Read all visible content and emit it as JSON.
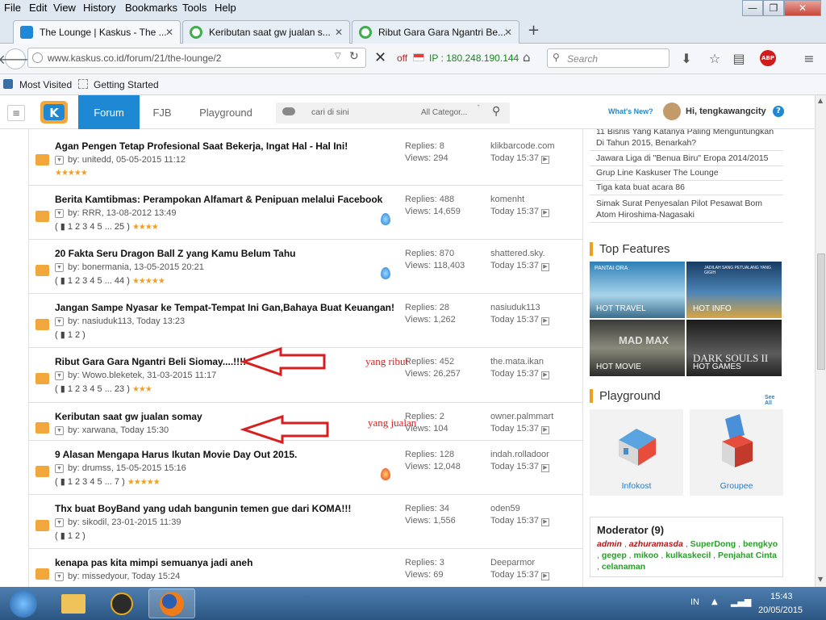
{
  "menu": [
    "File",
    "Edit",
    "View",
    "History",
    "Bookmarks",
    "Tools",
    "Help"
  ],
  "tabs": [
    {
      "title": "The Lounge | Kaskus - The ...",
      "active": true
    },
    {
      "title": "Keributan saat gw jualan s...",
      "active": false
    },
    {
      "title": "Ribut Gara Gara Ngantri Be...",
      "active": false
    }
  ],
  "new_tab": "+",
  "url": "www.kaskus.co.id/forum/21/the-lounge/2",
  "ip_off": "off",
  "ip_text": "IP : 180.248.190.144",
  "search_placeholder": "Search",
  "bookmarks": [
    "Most Visited",
    "Getting Started"
  ],
  "site": {
    "nav": [
      "Forum",
      "FJB",
      "Playground"
    ],
    "search_placeholder": "cari di sini",
    "category": "All Categor...",
    "whats_new": "What's New?",
    "greeting": "Hi, tengkawangcity",
    "help": "?"
  },
  "threads": [
    {
      "title": "Agan Pengen Tetap Profesional Saat Bekerja, Ingat Hal - Hal Ini!",
      "by": "by:",
      "author": "unitedd, 05-05-2015 11:12",
      "pages": "",
      "stars": "★★★★★",
      "replies": "Replies: 8",
      "views": "Views: 294",
      "last_user": "klikbarcode.com",
      "last_time": "Today 15:37",
      "hot": ""
    },
    {
      "title": "Berita Kamtibmas: Perampokan Alfamart & Penipuan melalui Facebook",
      "by": "by:",
      "author": "RRR, 13-08-2012 13:49",
      "pages": "( ▮ 1  2  3  4  5 ... 25 )",
      "stars": "★★★★",
      "replies": "Replies: 488",
      "views": "Views: 14,659",
      "last_user": "komenht",
      "last_time": "Today 15:37",
      "hot": "blue"
    },
    {
      "title": "20 Fakta Seru Dragon Ball Z yang Kamu Belum Tahu",
      "by": "by:",
      "author": "bonermania, 13-05-2015 20:21",
      "pages": "( ▮ 1  2  3  4  5 ... 44 )",
      "stars": "★★★★★",
      "replies": "Replies: 870",
      "views": "Views: 118,403",
      "last_user": "shattered.sky.",
      "last_time": "Today 15:37",
      "hot": "blue"
    },
    {
      "title": "Jangan Sampe Nyasar ke Tempat-Tempat Ini Gan,Bahaya Buat Keuangan!",
      "by": "by:",
      "author": "nasiuduk113, Today 13:23",
      "pages": "( ▮ 1  2 )",
      "stars": "",
      "replies": "Replies: 28",
      "views": "Views: 1,262",
      "last_user": "nasiuduk113",
      "last_time": "Today 15:37",
      "hot": ""
    },
    {
      "title": "Ribut Gara Gara Ngantri Beli Siomay....!!!!",
      "by": "by:",
      "author": "Wowo.bleketek, 31-03-2015 11:17",
      "pages": "( ▮ 1  2  3  4  5 ... 23 )",
      "stars": "★★★",
      "replies": "Replies: 452",
      "views": "Views: 26,257",
      "last_user": "the.mata.ikan",
      "last_time": "Today 15:37",
      "hot": ""
    },
    {
      "title": "Keributan saat gw jualan somay",
      "by": "by:",
      "author": "xarwana, Today 15:30",
      "pages": "",
      "stars": "",
      "replies": "Replies: 2",
      "views": "Views: 104",
      "last_user": "owner.palmmart",
      "last_time": "Today 15:37",
      "hot": ""
    },
    {
      "title": "9 Alasan Mengapa Harus Ikutan Movie Day Out 2015.",
      "by": "by:",
      "author": "drumss, 15-05-2015 15:16",
      "pages": "( ▮ 1  2  3  4  5 ... 7 )",
      "stars": "★★★★★",
      "replies": "Replies: 128",
      "views": "Views: 12,048",
      "last_user": "indah.rolladoor",
      "last_time": "Today 15:37",
      "hot": "red"
    },
    {
      "title": "Thx buat BoyBand yang udah bangunin temen gue dari KOMA!!!",
      "by": "by:",
      "author": "sikodil, 23-01-2015 11:39",
      "pages": "( ▮ 1  2 )",
      "stars": "",
      "replies": "Replies: 34",
      "views": "Views: 1,556",
      "last_user": "oden59",
      "last_time": "Today 15:37",
      "hot": ""
    },
    {
      "title": "kenapa pas kita mimpi semuanya jadi aneh",
      "by": "by:",
      "author": "missedyour, Today 15:24",
      "pages": "",
      "stars": "",
      "replies": "Replies: 3",
      "views": "Views: 69",
      "last_user": "Deeparmor",
      "last_time": "Today 15:37",
      "hot": ""
    }
  ],
  "annotations": {
    "ribut": "yang ribut",
    "jualan": "yang jualan"
  },
  "sidebar": {
    "links": [
      "11 Bisnis Yang Katanya Paling Menguntungkan Di Tahun 2015, Benarkah?",
      "Jawara Liga di \"Benua Biru\" Eropa 2014/2015",
      "Grup Line Kaskuser The Lounge",
      "Tiga kata buat acara 86",
      "Simak Surat Penyesalan Pilot Pesawat Bom Atom Hiroshima-Nagasaki"
    ],
    "top_features_title": "Top Features",
    "features": [
      "HOT TRAVEL",
      "HOT INFO",
      "HOT MOVIE",
      "HOT GAMES"
    ],
    "feature_overlay": [
      "PANTAI ORA",
      "JADILAH SANG PETUALANG YANG GIGIH",
      "MAD MAX",
      "DARK SOULS II"
    ],
    "playground_title": "Playground",
    "see_all": "See All",
    "playground_items": [
      "Infokost",
      "Groupee"
    ],
    "moderator_title": "Moderator (9)",
    "moderators": [
      {
        "name": "admin",
        "color": "#b01818"
      },
      {
        "name": "azhuramasda",
        "color": "#b01818"
      },
      {
        "name": "SuperDong",
        "color": "#2a9d2a"
      },
      {
        "name": "bengkyo",
        "color": "#2a9d2a"
      },
      {
        "name": "gegep",
        "color": "#2a9d2a"
      },
      {
        "name": "mikoo",
        "color": "#2a9d2a"
      },
      {
        "name": "kulkaskecil",
        "color": "#2a9d2a"
      },
      {
        "name": "Penjahat Cinta",
        "color": "#2a9d2a"
      },
      {
        "name": "celanaman",
        "color": "#2a9d2a"
      }
    ]
  },
  "taskbar": {
    "lang": "IN",
    "time": "15:43",
    "date": "20/05/2015"
  },
  "colors": {
    "accent": "#1e88d4",
    "star": "#f0a020"
  }
}
